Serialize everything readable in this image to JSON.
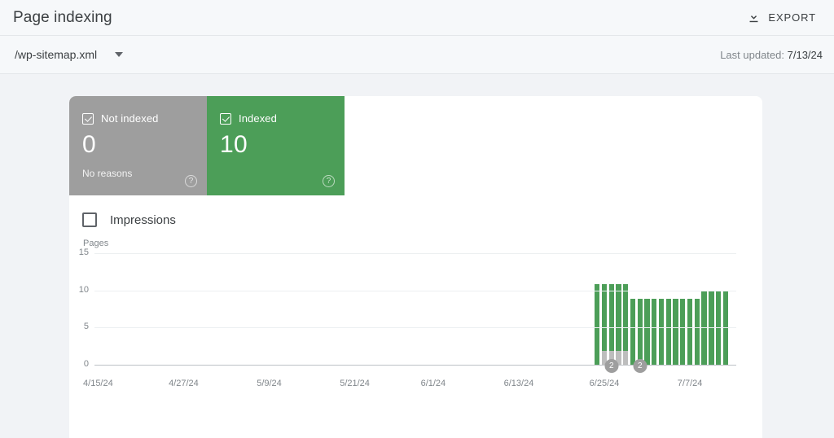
{
  "header": {
    "title": "Page indexing",
    "export_label": "EXPORT",
    "export_icon": "download-icon"
  },
  "subheader": {
    "sitemap": "/wp-sitemap.xml",
    "caret_icon": "chevron-down-icon",
    "last_updated_label": "Last updated:",
    "last_updated_value": "7/13/24"
  },
  "cards": [
    {
      "key": "not-indexed",
      "label": "Not indexed",
      "value": "0",
      "sub": "No reasons",
      "color": "#9e9e9e",
      "checked": true,
      "help_icon": "help-icon"
    },
    {
      "key": "indexed",
      "label": "Indexed",
      "value": "10",
      "sub": "",
      "color": "#4c9e58",
      "checked": true,
      "help_icon": "help-icon"
    }
  ],
  "impressions": {
    "label": "Impressions",
    "checked": false
  },
  "chart_data": {
    "type": "bar",
    "title": "",
    "ylabel": "Pages",
    "xlabel": "",
    "ylim": [
      0,
      15
    ],
    "yticks": [
      0,
      5,
      10,
      15
    ],
    "grid": true,
    "stacked": true,
    "legend_position": "top-cards",
    "colors": {
      "indexed": "#4c9e58",
      "not_indexed": "#bdbdbd"
    },
    "xtick_labels": [
      "4/15/24",
      "4/27/24",
      "5/9/24",
      "5/21/24",
      "6/1/24",
      "6/13/24",
      "6/25/24",
      "7/7/24"
    ],
    "xtick_indices": [
      0,
      12,
      24,
      36,
      47,
      59,
      71,
      83
    ],
    "x_start_date": "4/15/24",
    "n_points": 90,
    "series": [
      {
        "name": "Indexed",
        "color": "#4c9e58",
        "values": [
          0,
          0,
          0,
          0,
          0,
          0,
          0,
          0,
          0,
          0,
          0,
          0,
          0,
          0,
          0,
          0,
          0,
          0,
          0,
          0,
          0,
          0,
          0,
          0,
          0,
          0,
          0,
          0,
          0,
          0,
          0,
          0,
          0,
          0,
          0,
          0,
          0,
          0,
          0,
          0,
          0,
          0,
          0,
          0,
          0,
          0,
          0,
          0,
          0,
          0,
          0,
          0,
          0,
          0,
          0,
          0,
          0,
          0,
          0,
          0,
          0,
          0,
          0,
          0,
          0,
          0,
          0,
          0,
          0,
          0,
          11,
          11,
          11,
          11,
          11,
          9,
          9,
          9,
          9,
          9,
          9,
          9,
          9,
          9,
          9,
          10,
          10,
          10,
          10,
          0
        ]
      },
      {
        "name": "Not indexed",
        "color": "#bdbdbd",
        "values": [
          0,
          0,
          0,
          0,
          0,
          0,
          0,
          0,
          0,
          0,
          0,
          0,
          0,
          0,
          0,
          0,
          0,
          0,
          0,
          0,
          0,
          0,
          0,
          0,
          0,
          0,
          0,
          0,
          0,
          0,
          0,
          0,
          0,
          0,
          0,
          0,
          0,
          0,
          0,
          0,
          0,
          0,
          0,
          0,
          0,
          0,
          0,
          0,
          0,
          0,
          0,
          0,
          0,
          0,
          0,
          0,
          0,
          0,
          0,
          0,
          0,
          0,
          0,
          0,
          0,
          0,
          0,
          0,
          0,
          0,
          0,
          2,
          2,
          2,
          2,
          0,
          0,
          0,
          0,
          0,
          0,
          0,
          0,
          0,
          0,
          0,
          0,
          0,
          0,
          0
        ]
      }
    ],
    "annotations": [
      {
        "label": "2",
        "index": 72
      },
      {
        "label": "2",
        "index": 76
      }
    ]
  }
}
